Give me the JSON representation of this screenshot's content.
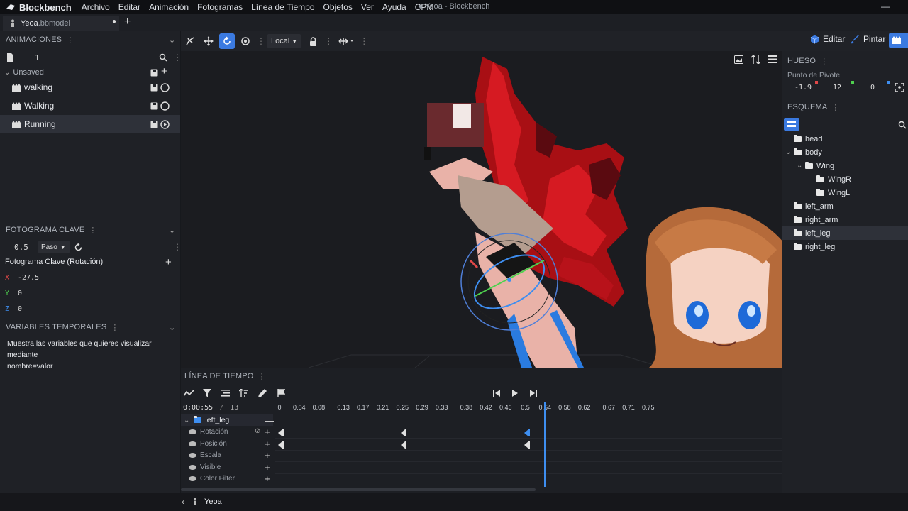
{
  "menubar": {
    "app_name": "Blockbench",
    "menus": [
      "Archivo",
      "Editar",
      "Animación",
      "Fotogramas",
      "Línea de Tiempo",
      "Objetos",
      "Ver",
      "Ayuda",
      "CPM"
    ],
    "window_title": "● Yeoa - Blockbench",
    "minimize": "—"
  },
  "tabs": {
    "file_name": "Yeoa",
    "file_ext": ".bbmodel",
    "dot": "●",
    "add": "+"
  },
  "toolbar": {
    "space_label": "Local",
    "mode_edit": "Editar",
    "mode_paint": "Pintar"
  },
  "animations": {
    "header": "ANIMACIONES",
    "page_value": "1",
    "group_label": "Unsaved",
    "items": [
      {
        "label": "walking"
      },
      {
        "label": "Walking"
      },
      {
        "label": "Running"
      }
    ]
  },
  "keyframe": {
    "header": "FOTOGRAMA CLAVE",
    "time_value": "0.5",
    "interpolation": "Paso",
    "section_title": "Fotograma Clave (Rotación)",
    "axes": [
      {
        "axis": "X",
        "value": "-27.5",
        "color": "#e04848"
      },
      {
        "axis": "Y",
        "value": "0",
        "color": "#4fd14f"
      },
      {
        "axis": "Z",
        "value": "0",
        "color": "#3e8ef0"
      }
    ]
  },
  "variables": {
    "header": "VARIABLES TEMPORALES",
    "description_line1": "Muestra las variables que quieres visualizar mediante",
    "description_line2": "nombre=valor"
  },
  "bone": {
    "header": "HUESO",
    "pivot_label": "Punto de Pivote",
    "pivot": [
      "-1.9",
      "12",
      "0"
    ]
  },
  "outliner": {
    "header": "ESQUEMA",
    "items": [
      {
        "label": "head",
        "indent": 0,
        "arrow": ""
      },
      {
        "label": "body",
        "indent": 0,
        "arrow": "v"
      },
      {
        "label": "Wing",
        "indent": 1,
        "arrow": "v"
      },
      {
        "label": "WingR",
        "indent": 2,
        "arrow": ""
      },
      {
        "label": "WingL",
        "indent": 2,
        "arrow": ""
      },
      {
        "label": "left_arm",
        "indent": 0,
        "arrow": ""
      },
      {
        "label": "right_arm",
        "indent": 0,
        "arrow": ""
      },
      {
        "label": "left_leg",
        "indent": 0,
        "arrow": "",
        "selected": true
      },
      {
        "label": "right_leg",
        "indent": 0,
        "arrow": ""
      }
    ]
  },
  "timeline": {
    "header": "LÍNEA DE TIEMPO",
    "current_time": "0:00:55",
    "separator": "/",
    "total": "13",
    "ticks": [
      "0",
      "0.04",
      "0.08",
      "0.13",
      "0.17",
      "0.21",
      "0.25",
      "0.29",
      "0.33",
      "0.38",
      "0.42",
      "0.46",
      "0.5",
      "0.54",
      "0.58",
      "0.62",
      "0.67",
      "0.71",
      "0.75"
    ],
    "bone_name": "left_leg",
    "channels": [
      {
        "label": "Rotación",
        "keyframes": [
          0,
          0.25,
          0.5
        ]
      },
      {
        "label": "Posición",
        "keyframes": [
          0,
          0.25,
          0.5
        ]
      },
      {
        "label": "Escala",
        "keyframes": []
      },
      {
        "label": "Visible",
        "keyframes": []
      },
      {
        "label": "Color Filter",
        "keyframes": []
      }
    ],
    "playhead_time": 0.54,
    "selected_keyframe": 0.5
  },
  "statusbar": {
    "model_name": "Yeoa"
  },
  "colors": {
    "accent": "#3b7ae0",
    "wing_red": "#c4141c",
    "skin": "#e9b2a8"
  }
}
